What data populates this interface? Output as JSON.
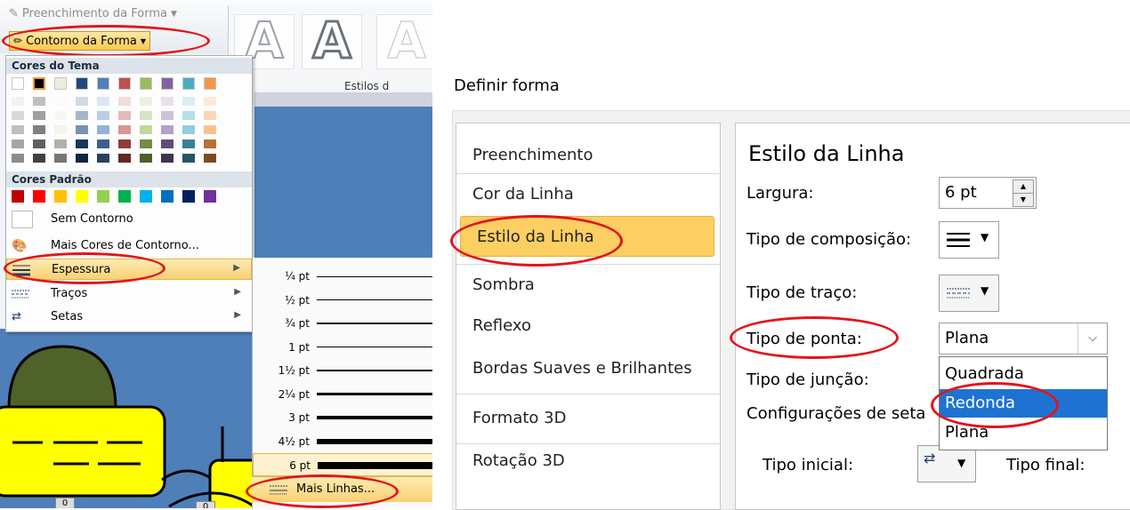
{
  "ribbon": {
    "fill_label": "Preenchimento da Forma",
    "outline_label": "Contorno da Forma",
    "styles_label": "Estilos d",
    "wordart_glyph": "A"
  },
  "outline_menu": {
    "theme_colors_heading": "Cores do Tema",
    "standard_colors_heading": "Cores Padrão",
    "theme_row": [
      "#ffffff",
      "#000000",
      "#eeece1",
      "#1f497d",
      "#4f81bd",
      "#c0504d",
      "#9bbb59",
      "#8064a2",
      "#4bacc6",
      "#f79646"
    ],
    "standard_colors": [
      "#c00000",
      "#ff0000",
      "#ffc000",
      "#ffff00",
      "#92d050",
      "#00b050",
      "#00b0f0",
      "#0070c0",
      "#002060",
      "#7030a0"
    ],
    "items": {
      "no_outline": "Sem Contorno",
      "more_colors": "Mais Cores de Contorno...",
      "weight": "Espessura",
      "dashes": "Traços",
      "arrows": "Setas"
    }
  },
  "weight_submenu": {
    "options": [
      "¼ pt",
      "½ pt",
      "¾ pt",
      "1 pt",
      "1½ pt",
      "2¼ pt",
      "3 pt",
      "4½ pt",
      "6 pt"
    ],
    "more_lines": "Mais Linhas...",
    "selected": "6 pt"
  },
  "drawing": {
    "badge_1": "0",
    "badge_2": "0"
  },
  "dialog": {
    "title": "Definir forma",
    "nav": [
      "Preenchimento",
      "Cor da Linha",
      "Estilo da Linha",
      "Sombra",
      "Reflexo",
      "Bordas Suaves e Brilhantes",
      "Formato 3D",
      "Rotação 3D"
    ],
    "nav_selected": "Estilo da Linha",
    "section_title": "Estilo da Linha",
    "width_label": "Largura:",
    "width_value": "6 pt",
    "compound_label": "Tipo de composição:",
    "dash_label": "Tipo de traço:",
    "cap_label": "Tipo de ponta:",
    "cap_value": "Plana",
    "cap_options": [
      "Quadrada",
      "Redonda",
      "Plana"
    ],
    "cap_highlighted": "Redonda",
    "join_label": "Tipo de junção:",
    "arrow_settings_label": "Configurações de seta",
    "begin_type_label": "Tipo inicial:",
    "end_type_label": "Tipo final:"
  },
  "colors": {
    "highlight_orange": "#fccf63",
    "selection_blue": "#1e73d2",
    "annotation_red": "#e3141b",
    "slide_blue": "#4e7fb9"
  }
}
